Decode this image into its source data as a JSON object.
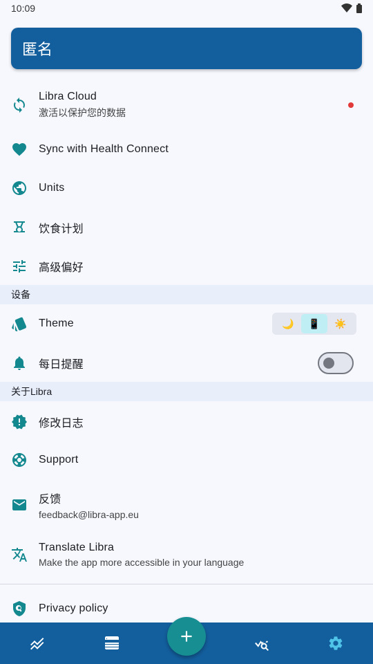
{
  "status_bar": {
    "time": "10:09"
  },
  "header": {
    "title": "匿名"
  },
  "items": {
    "libra_cloud": {
      "title": "Libra Cloud",
      "sub": "激活以保护您的数据"
    },
    "health_connect": {
      "title": "Sync with Health Connect"
    },
    "units": {
      "title": "Units"
    },
    "diet_plan": {
      "title": "饮食计划"
    },
    "advanced": {
      "title": "高级偏好"
    }
  },
  "sections": {
    "device": "设备",
    "about": "关于Libra"
  },
  "device": {
    "theme": {
      "title": "Theme",
      "options": [
        "🌙",
        "📱",
        "☀️"
      ],
      "selected_index": 1
    },
    "daily_reminder": {
      "title": "每日提醒",
      "enabled": false
    }
  },
  "about": {
    "changelog": {
      "title": "修改日志"
    },
    "support": {
      "title": "Support"
    },
    "feedback": {
      "title": "反馈",
      "sub": "feedback@libra-app.eu"
    },
    "translate": {
      "title": "Translate Libra",
      "sub": "Make the app more accessible in your language"
    },
    "privacy": {
      "title": "Privacy policy"
    }
  },
  "colors": {
    "accent": "#13888e",
    "primary": "#135f9e",
    "notification_dot": "#e23a3a"
  },
  "nav": [
    "trend-icon",
    "list-icon",
    "add-icon",
    "analytics-icon",
    "settings-icon"
  ]
}
